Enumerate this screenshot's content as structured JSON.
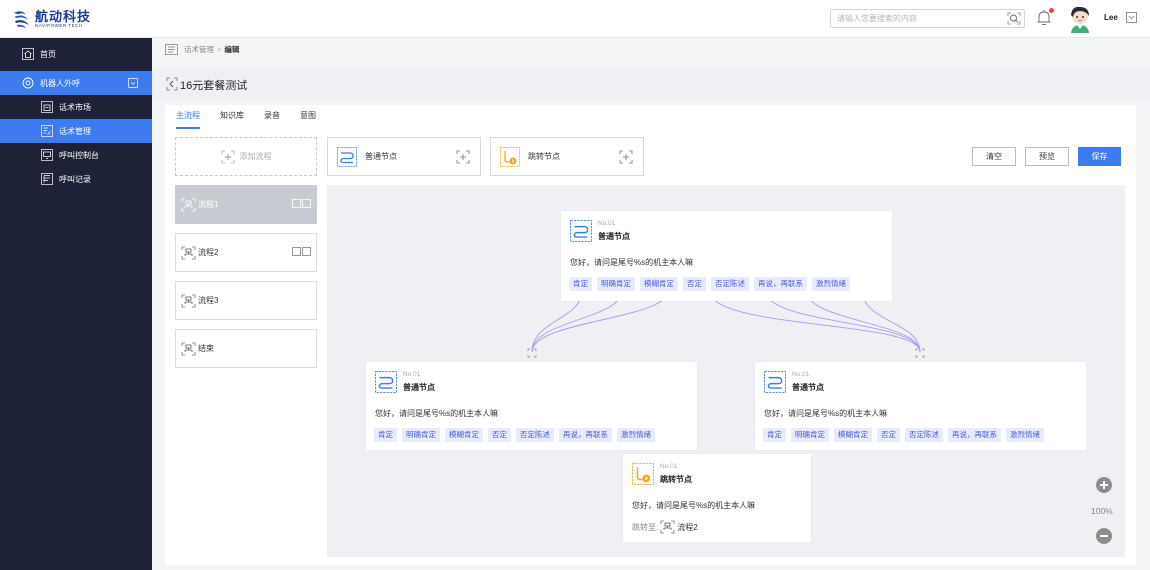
{
  "header": {
    "logo_text": "航动科技",
    "logo_sub": "NAVIPOWER TECH",
    "search_placeholder": "请输入您要搜索的内容",
    "username": "Lee"
  },
  "sidebar": {
    "home": "首页",
    "robot_outbound": "机器人外呼",
    "items": [
      "话术市场",
      "话术管理",
      "呼叫控制台",
      "呼叫记录"
    ]
  },
  "breadcrumb": {
    "parent": "话术管理",
    "separator": ">",
    "current": "编辑"
  },
  "page_title": "16元套餐测试",
  "tabs": [
    "主流程",
    "知识库",
    "录音",
    "意图"
  ],
  "toolbar": {
    "add_flow": "添加流程",
    "normal_node": "普通节点",
    "jump_node": "跳转节点",
    "clear": "清空",
    "preview": "预览",
    "save": "保存"
  },
  "flows": [
    "流程1",
    "流程2",
    "流程3",
    "结束"
  ],
  "canvas": {
    "cards": {
      "top": {
        "no": "No.01",
        "title": "普通节点",
        "text": "您好，请问是尾号%s的机主本人嘛",
        "tags": [
          "肯定",
          "明确肯定",
          "模糊肯定",
          "否定",
          "否定陈述",
          "再说，再联系",
          "激烈情绪"
        ]
      },
      "left": {
        "no": "No.01",
        "title": "普通节点",
        "text": "您好，请问是尾号%s的机主本人嘛",
        "tags": [
          "肯定",
          "明确肯定",
          "模糊肯定",
          "否定",
          "否定陈述",
          "再说，再联系",
          "激烈情绪"
        ]
      },
      "right": {
        "no": "No.01",
        "title": "普通节点",
        "text": "您好，请问是尾号%s的机主本人嘛",
        "tags": [
          "肯定",
          "明确肯定",
          "模糊肯定",
          "否定",
          "否定陈述",
          "再说，再联系",
          "激烈情绪"
        ]
      },
      "jump": {
        "no": "No.01",
        "title": "跳转节点",
        "text": "您好，请问是尾号%s的机主本人嘛",
        "jump_label": "跳转至:",
        "jump_target": "流程2"
      }
    },
    "zoom": "100%"
  },
  "colors": {
    "primary": "#3d7cf0",
    "sidebar_bg": "#1d2238",
    "tag_bg": "#e8ebfc",
    "tag_text": "#4a5bd9",
    "link_line": "#9a8ef0",
    "jump_orange": "#f5a623"
  }
}
